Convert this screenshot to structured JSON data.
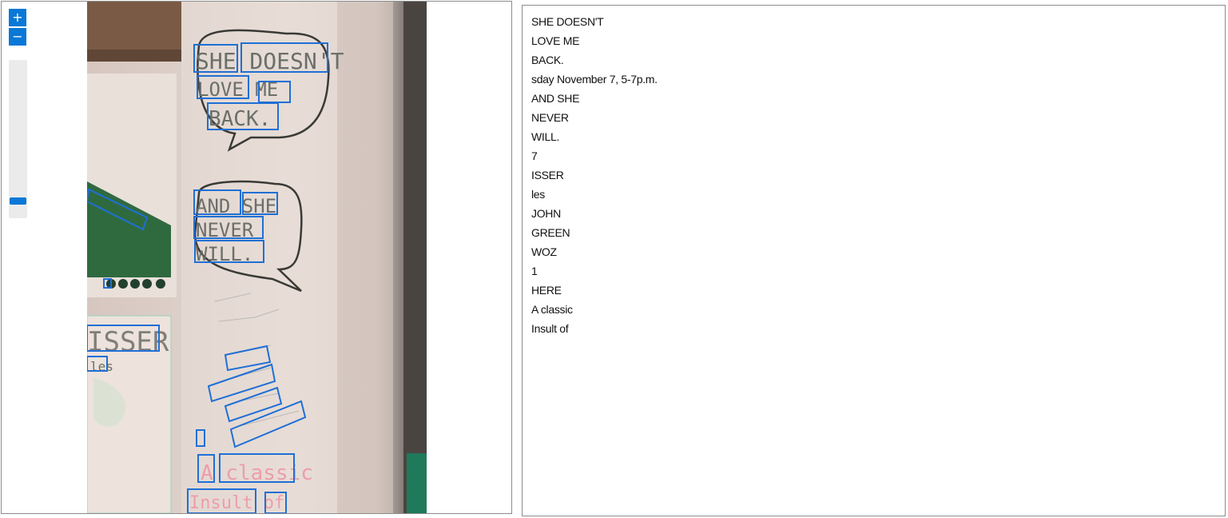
{
  "viewer": {
    "zoom_in_label": "+",
    "zoom_out_label": "−",
    "zoom_level": 0.08
  },
  "extracted_lines": [
    "SHE DOESN'T",
    "LOVE ME",
    "BACK.",
    "sday November 7, 5-7p.m.",
    "AND SHE",
    "NEVER",
    "WILL.",
    "7",
    "ISSER",
    "les",
    "JOHN",
    "GREEN",
    "WOZ",
    "1",
    "HERE",
    "A classic",
    "Insult of"
  ],
  "colors": {
    "accent": "#0a78d7",
    "box": "#1f6fd6"
  }
}
